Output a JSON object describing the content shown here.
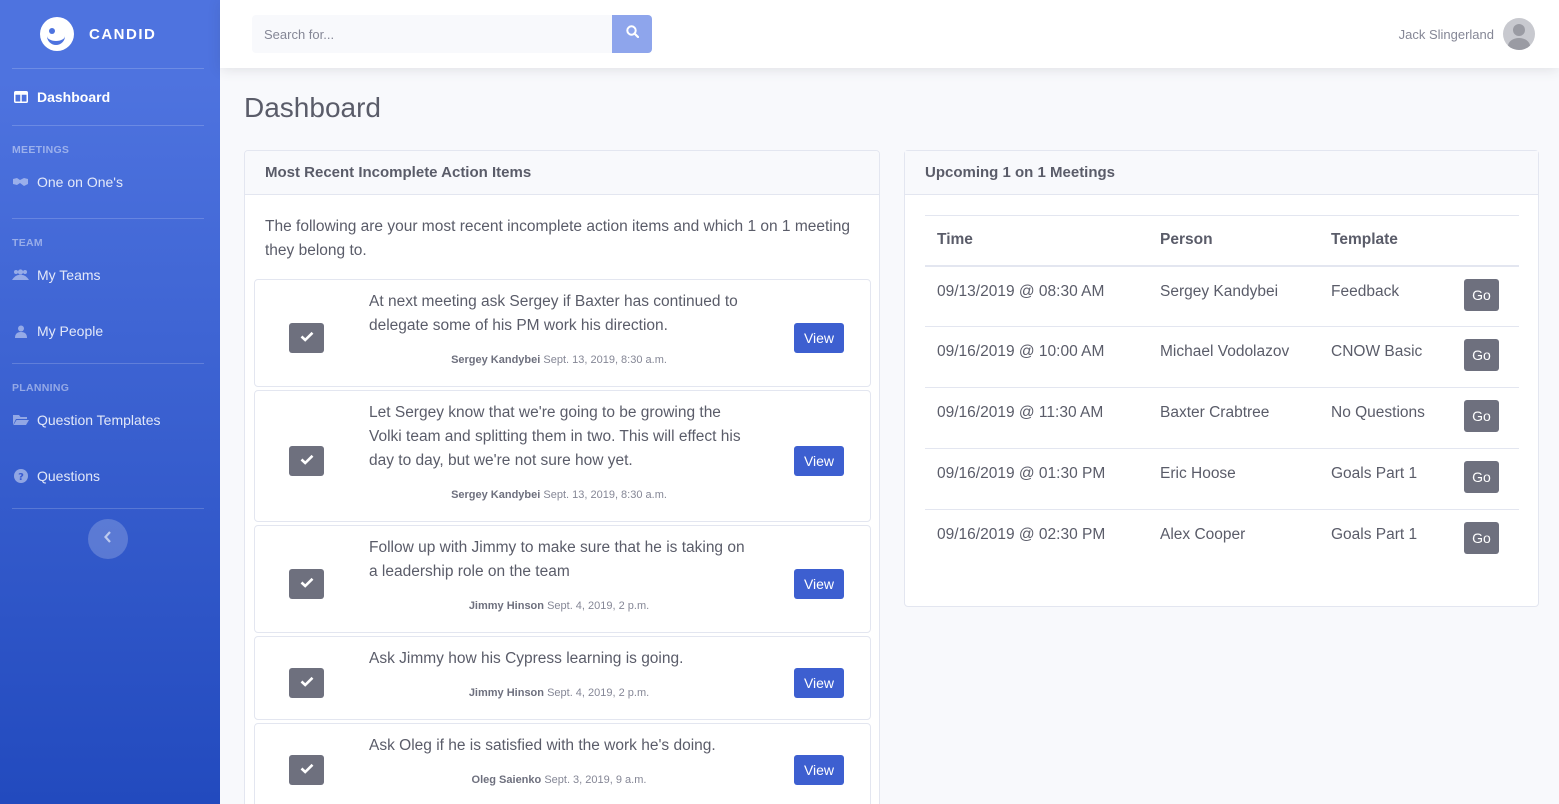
{
  "brand": {
    "name": "CANDID"
  },
  "sidebar": {
    "items": [
      {
        "label": "Dashboard",
        "icon": "columns-icon",
        "active": true
      },
      {
        "label": "One on One's",
        "icon": "handshake-icon"
      },
      {
        "label": "My Teams",
        "icon": "users-icon"
      },
      {
        "label": "My People",
        "icon": "user-icon"
      },
      {
        "label": "Question Templates",
        "icon": "folder-icon"
      },
      {
        "label": "Questions",
        "icon": "question-circle-icon"
      }
    ],
    "headings": {
      "meetings": "MEETINGS",
      "team": "TEAM",
      "planning": "PLANNING"
    },
    "toggle_icon": "chevron-left-icon"
  },
  "search": {
    "placeholder": "Search for..."
  },
  "user": {
    "name": "Jack Slingerland"
  },
  "page": {
    "title": "Dashboard"
  },
  "action_items": {
    "header": "Most Recent Incomplete Action Items",
    "intro": "The following are your most recent incomplete action items and which 1 on 1 meeting they belong to.",
    "view_label": "View",
    "items": [
      {
        "text": "At next meeting ask Sergey if Baxter has continued to delegate some of his PM work his direction.",
        "person": "Sergey Kandybei",
        "date": "Sept. 13, 2019, 8:30 a.m."
      },
      {
        "text": "Let Sergey know that we're going to be growing the Volki team and splitting them in two. This will effect his day to day, but we're not sure how yet.",
        "person": "Sergey Kandybei",
        "date": "Sept. 13, 2019, 8:30 a.m."
      },
      {
        "text": "Follow up with Jimmy to make sure that he is taking on a leadership role on the team",
        "person": "Jimmy Hinson",
        "date": "Sept. 4, 2019, 2 p.m."
      },
      {
        "text": "Ask Jimmy how his Cypress learning is going.",
        "person": "Jimmy Hinson",
        "date": "Sept. 4, 2019, 2 p.m."
      },
      {
        "text": "Ask Oleg if he is satisfied with the work he's doing.",
        "person": "Oleg Saienko",
        "date": "Sept. 3, 2019, 9 a.m."
      }
    ]
  },
  "meetings": {
    "header": "Upcoming 1 on 1 Meetings",
    "columns": [
      "Time",
      "Person",
      "Template"
    ],
    "go_label": "Go",
    "rows": [
      {
        "time": "09/13/2019 @ 08:30 AM",
        "person": "Sergey Kandybei",
        "template": "Feedback"
      },
      {
        "time": "09/16/2019 @ 10:00 AM",
        "person": "Michael Vodolazov",
        "template": "CNOW Basic"
      },
      {
        "time": "09/16/2019 @ 11:30 AM",
        "person": "Baxter Crabtree",
        "template": "No Questions"
      },
      {
        "time": "09/16/2019 @ 01:30 PM",
        "person": "Eric Hoose",
        "template": "Goals Part 1"
      },
      {
        "time": "09/16/2019 @ 02:30 PM",
        "person": "Alex Cooper",
        "template": "Goals Part 1"
      }
    ]
  }
}
